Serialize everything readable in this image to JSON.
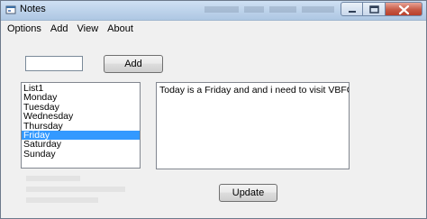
{
  "window": {
    "title": "Notes",
    "icon": "app-window-icon",
    "controls": [
      "minimize-icon",
      "maximize-icon",
      "close-icon"
    ]
  },
  "menu": [
    {
      "label": "Options"
    },
    {
      "label": "Add"
    },
    {
      "label": "View"
    },
    {
      "label": "About"
    }
  ],
  "add_form": {
    "input_value": "",
    "button_label": "Add"
  },
  "list": {
    "items": [
      "List1",
      "Monday",
      "Tuesday",
      "Wednesday",
      "Thursday",
      "Friday",
      "Saturday",
      "Sunday"
    ],
    "selected": "Friday"
  },
  "note": {
    "text": "Today is a Friday and and i need to visit VBFORUM's and ask"
  },
  "update_button": {
    "label": "Update"
  },
  "colors": {
    "selection": "#3399ff",
    "window_bg": "#f0f0f0"
  }
}
